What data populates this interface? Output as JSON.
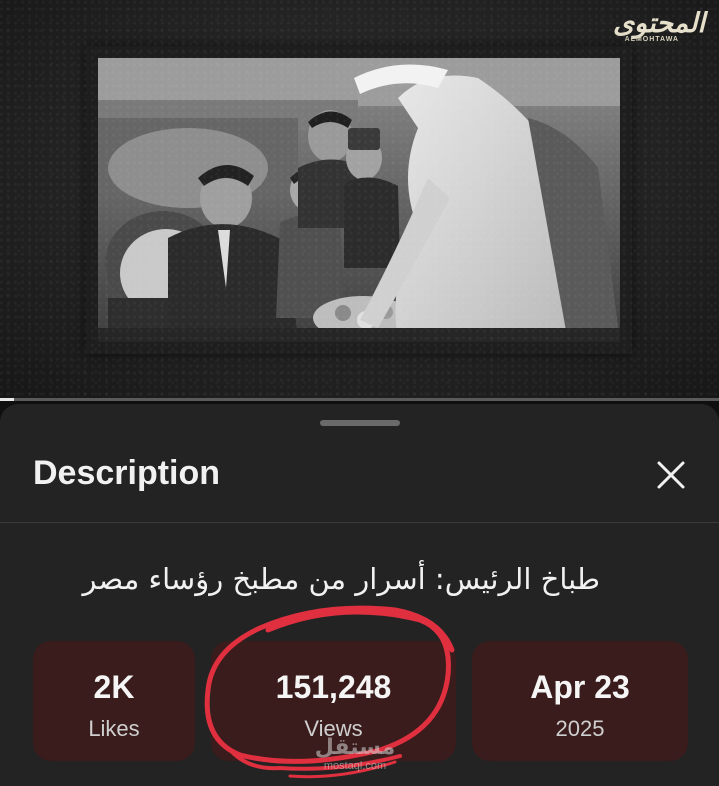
{
  "video": {
    "logo_main": "المحتوى",
    "logo_sub": "ALMOHTAWA",
    "progress_fraction": 0.02
  },
  "sheet": {
    "title": "Description",
    "close_icon": "close-icon",
    "video_title": "طباخ الرئيس: أسرار من مطبخ رؤساء مصر"
  },
  "stats": {
    "likes": {
      "value": "2K",
      "label": "Likes"
    },
    "views": {
      "value": "151,248",
      "label": "Views"
    },
    "date": {
      "value": "Apr 23",
      "label": "2025"
    }
  },
  "annotation": {
    "color": "#e0303f",
    "shape": "hand-drawn-circle"
  },
  "watermark": {
    "arabic": "مستقل",
    "latin": "mostaql.com"
  },
  "colors": {
    "sheet_bg": "#232323",
    "stat_card_bg": "#3a1c1c",
    "annotation": "#e0303f"
  }
}
